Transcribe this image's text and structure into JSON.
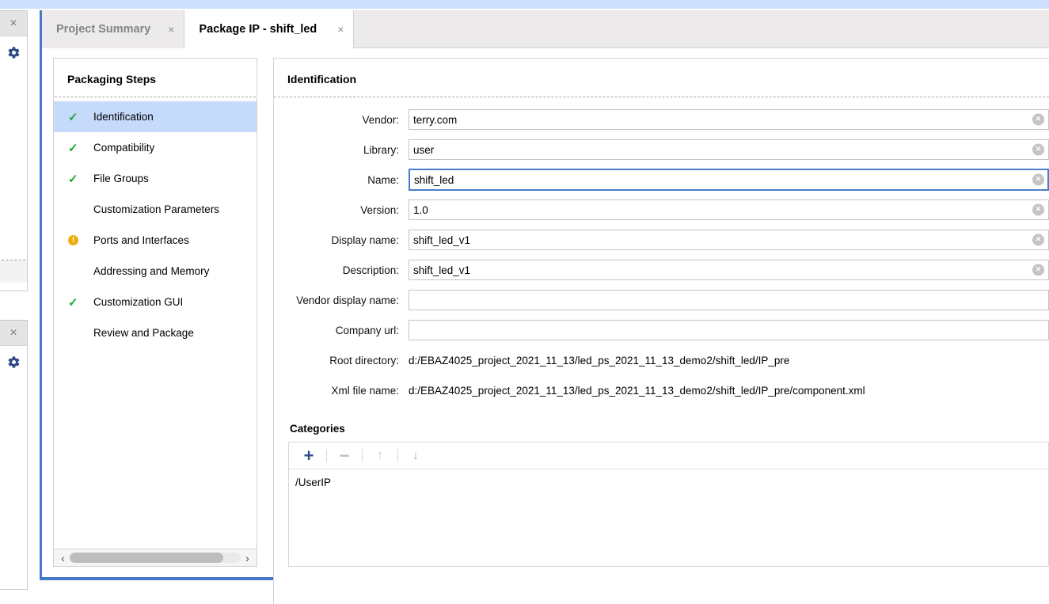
{
  "window": {
    "accent_color": "#4678c8",
    "top_strip_color": "#cddffa"
  },
  "dock_panels": [
    {
      "close_icon": "×",
      "gear_icon": "⚙"
    },
    {
      "close_icon": "×",
      "gear_icon": "⚙"
    }
  ],
  "tabs": [
    {
      "label": "Project Summary",
      "close": "×",
      "active": false
    },
    {
      "label": "Package IP - shift_led",
      "close": "×",
      "active": true
    }
  ],
  "sidebar": {
    "title": "Packaging Steps",
    "items": [
      {
        "label": "Identification",
        "status": "check",
        "selected": true
      },
      {
        "label": "Compatibility",
        "status": "check",
        "selected": false
      },
      {
        "label": "File Groups",
        "status": "check",
        "selected": false
      },
      {
        "label": "Customization Parameters",
        "status": "none",
        "selected": false
      },
      {
        "label": "Ports and Interfaces",
        "status": "warning",
        "selected": false
      },
      {
        "label": "Addressing and Memory",
        "status": "none",
        "selected": false
      },
      {
        "label": "Customization GUI",
        "status": "check",
        "selected": false
      },
      {
        "label": "Review and Package",
        "status": "none",
        "selected": false
      }
    ],
    "check_color": "#1eab2e",
    "warning_color": "#eead0e",
    "selected_color": "#c6dafc",
    "scrollbar": {
      "left_arrow": "‹",
      "right_arrow": "›"
    }
  },
  "identification": {
    "title": "Identification",
    "fields": [
      {
        "label": "Vendor:",
        "value": "terry.com",
        "placeholder": "",
        "focused": false,
        "clearable": true
      },
      {
        "label": "Library:",
        "value": "user",
        "placeholder": "",
        "focused": false,
        "clearable": true
      },
      {
        "label": "Name:",
        "value": "shift_led",
        "placeholder": "",
        "focused": true,
        "clearable": true
      },
      {
        "label": "Version:",
        "value": "1.0",
        "placeholder": "",
        "focused": false,
        "clearable": true
      },
      {
        "label": "Display name:",
        "value": "shift_led_v1",
        "placeholder": "",
        "focused": false,
        "clearable": true
      },
      {
        "label": "Description:",
        "value": "shift_led_v1",
        "placeholder": "",
        "focused": false,
        "clearable": true
      },
      {
        "label": "Vendor display name:",
        "value": "",
        "placeholder": "",
        "focused": false,
        "clearable": false
      },
      {
        "label": "Company url:",
        "value": "",
        "placeholder": "",
        "focused": false,
        "clearable": false
      }
    ],
    "static_rows": [
      {
        "label": "Root directory:",
        "value": "d:/EBAZ4025_project_2021_11_13/led_ps_2021_11_13_demo2/shift_led/IP_pre"
      },
      {
        "label": "Xml file name:",
        "value": "d:/EBAZ4025_project_2021_11_13/led_ps_2021_11_13_demo2/shift_led/IP_pre/component.xml"
      }
    ],
    "clear_icon": "×"
  },
  "categories": {
    "title": "Categories",
    "toolbar": {
      "add_label": "+",
      "remove_label": "−",
      "move_up_label": "↑",
      "move_down_label": "↓"
    },
    "items": [
      "/UserIP"
    ]
  }
}
